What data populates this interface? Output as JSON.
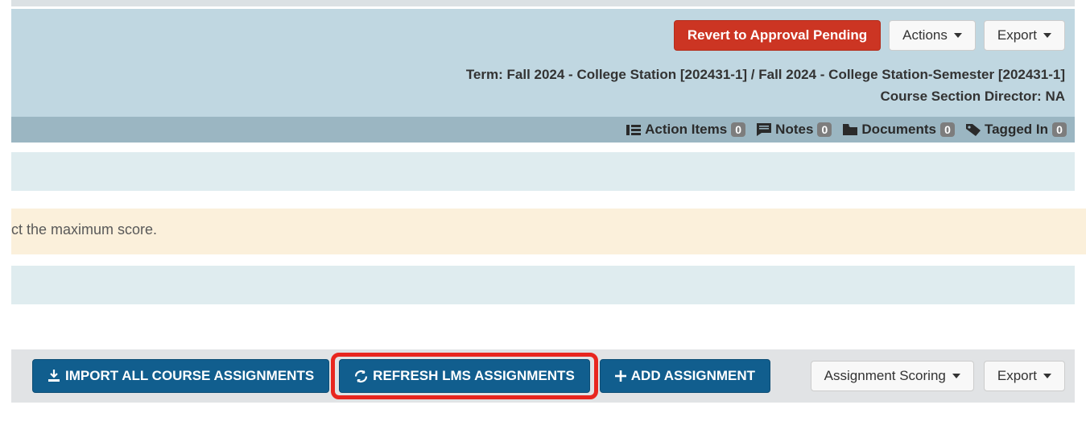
{
  "header": {
    "revert_label": "Revert to Approval Pending",
    "actions_label": "Actions",
    "export_label": "Export",
    "term_line": "Term: Fall 2024 - College Station [202431-1] / Fall 2024 - College Station-Semester [202431-1]",
    "director_line": "Course Section Director: NA"
  },
  "status": {
    "action_items": {
      "label": "Action Items",
      "count": "0"
    },
    "notes": {
      "label": "Notes",
      "count": "0"
    },
    "documents": {
      "label": "Documents",
      "count": "0"
    },
    "tagged_in": {
      "label": "Tagged In",
      "count": "0"
    }
  },
  "warning": {
    "text": "ct the maximum score."
  },
  "toolbar": {
    "import_label": "IMPORT ALL COURSE ASSIGNMENTS",
    "refresh_label": "REFRESH LMS ASSIGNMENTS",
    "add_label": "ADD ASSIGNMENT",
    "scoring_label": "Assignment Scoring",
    "export_label": "Export"
  }
}
